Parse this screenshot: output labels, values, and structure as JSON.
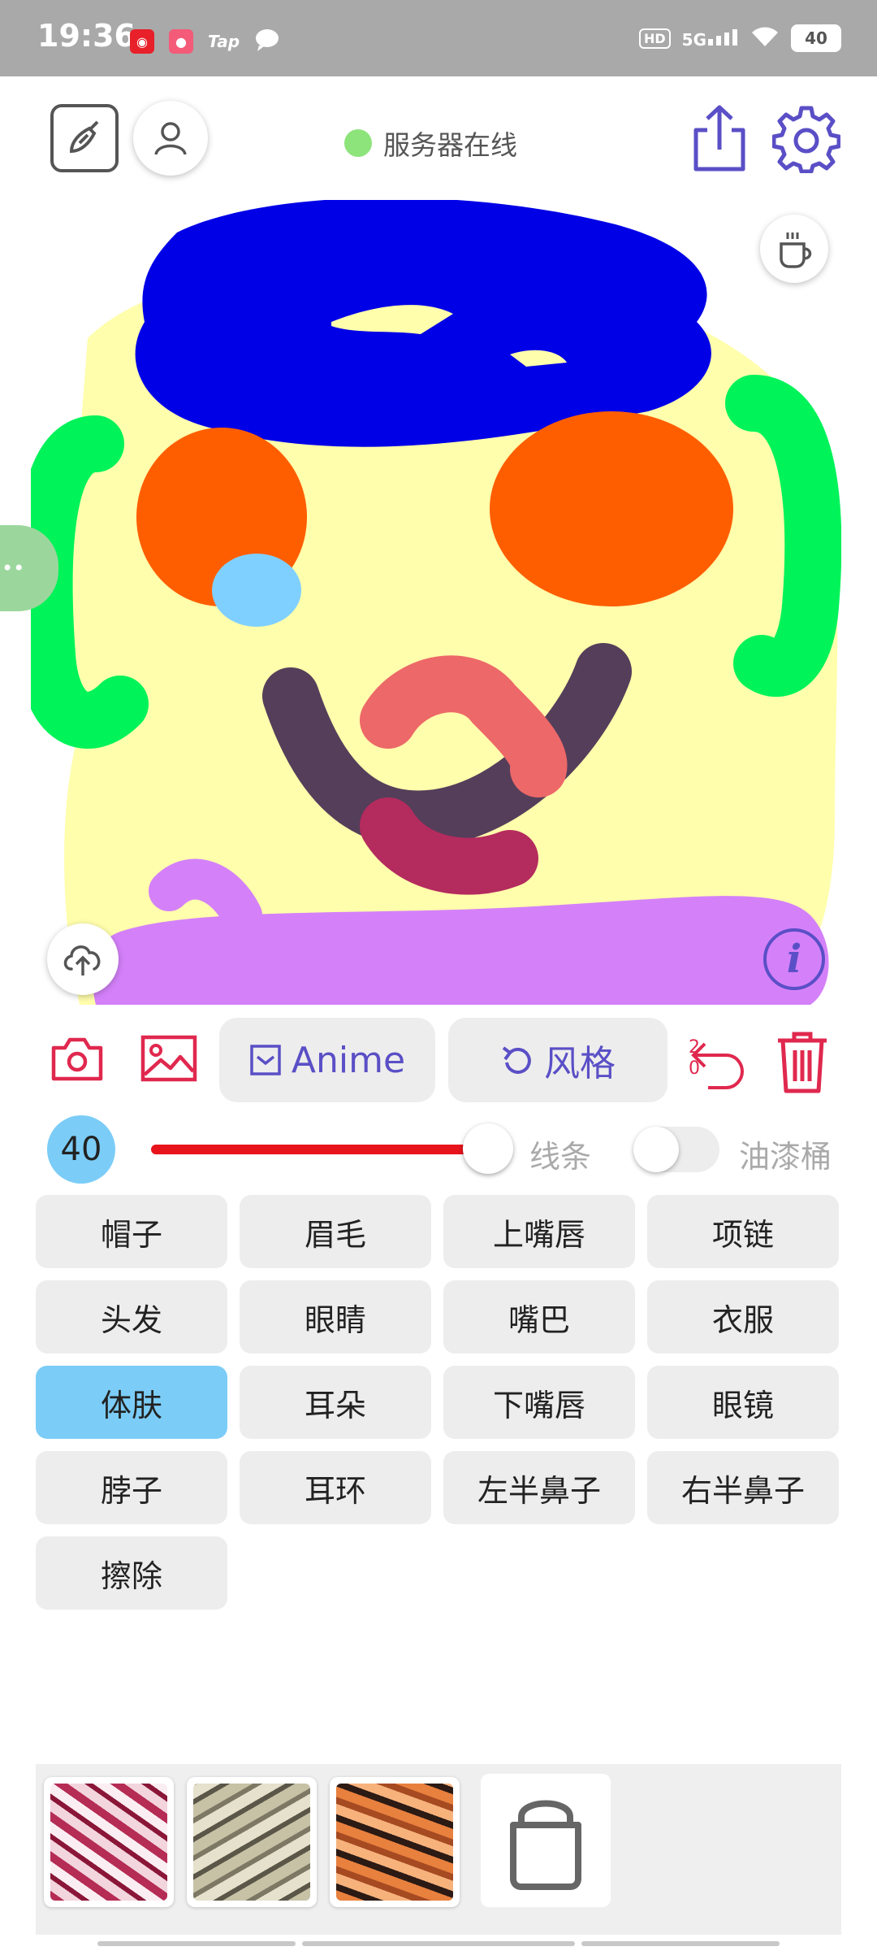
{
  "status_bar": {
    "time": "19:36",
    "tap_label": "Tap",
    "network": "5G",
    "hd": "HD",
    "battery": "40"
  },
  "header": {
    "server_status": "服务器在线",
    "server_status_color": "#8ce47a"
  },
  "actions": {
    "anime_label": "Anime",
    "style_label": "风格",
    "undo_count_top": "2",
    "undo_count_bottom": "0"
  },
  "brush": {
    "size": "40",
    "line_label": "线条",
    "bucket_label": "油漆桶",
    "slider_fraction": 0.94,
    "bucket_enabled": false
  },
  "parts": [
    {
      "label": "帽子",
      "active": false
    },
    {
      "label": "眉毛",
      "active": false
    },
    {
      "label": "上嘴唇",
      "active": false
    },
    {
      "label": "项链",
      "active": false
    },
    {
      "label": "头发",
      "active": false
    },
    {
      "label": "眼睛",
      "active": false
    },
    {
      "label": "嘴巴",
      "active": false
    },
    {
      "label": "衣服",
      "active": false
    },
    {
      "label": "体肤",
      "active": true
    },
    {
      "label": "耳朵",
      "active": false
    },
    {
      "label": "下嘴唇",
      "active": false
    },
    {
      "label": "眼镜",
      "active": false
    },
    {
      "label": "脖子",
      "active": false
    },
    {
      "label": "耳环",
      "active": false
    },
    {
      "label": "左半鼻子",
      "active": false
    },
    {
      "label": "右半鼻子",
      "active": false
    },
    {
      "label": "擦除",
      "active": false
    }
  ],
  "colors": {
    "accent": "#5a4fc6",
    "danger": "#e0284e",
    "active_part": "#7bcdf7"
  },
  "style_thumbs": [
    {
      "name": "style-thumb-red"
    },
    {
      "name": "style-thumb-gray"
    },
    {
      "name": "style-thumb-orange"
    }
  ]
}
